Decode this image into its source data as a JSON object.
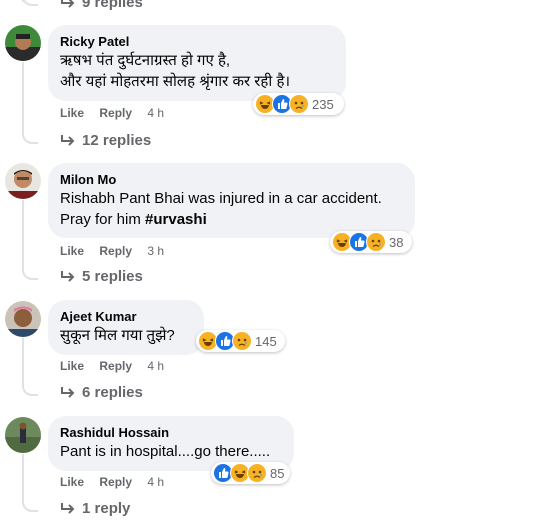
{
  "top_replies": "9 replies",
  "comments": [
    {
      "author": "Ricky Patel",
      "text": "ऋषभ पंत दुर्घटनाग्रस्त हो गए है,\nऔर यहां मोहतरमा सोलह श्रृंगार कर रही है।",
      "like": "Like",
      "reply": "Reply",
      "time": "4 h",
      "reaction_count": "235",
      "replies": "12 replies"
    },
    {
      "author": "Milon Mo",
      "text": "Rishabh Pant Bhai was injured in a car accident.\nPray for him ",
      "hashtag": "#urvashi",
      "like": "Like",
      "reply": "Reply",
      "time": "3 h",
      "reaction_count": "38",
      "replies": "5 replies"
    },
    {
      "author": "Ajeet Kumar",
      "text": "सुकून मिल गया तुझे?",
      "like": "Like",
      "reply": "Reply",
      "time": "4 h",
      "reaction_count": "145",
      "replies": "6 replies"
    },
    {
      "author": "Rashidul Hossain",
      "text": "Pant is in hospital....go there.....",
      "like": "Like",
      "reply": "Reply",
      "time": "4 h",
      "reaction_count": "85",
      "replies": "1 reply"
    }
  ],
  "icons": {
    "reply_arrow": "reply-arrow-icon",
    "reactions": [
      "haha-reaction-icon",
      "like-reaction-icon",
      "sad-reaction-icon"
    ]
  }
}
